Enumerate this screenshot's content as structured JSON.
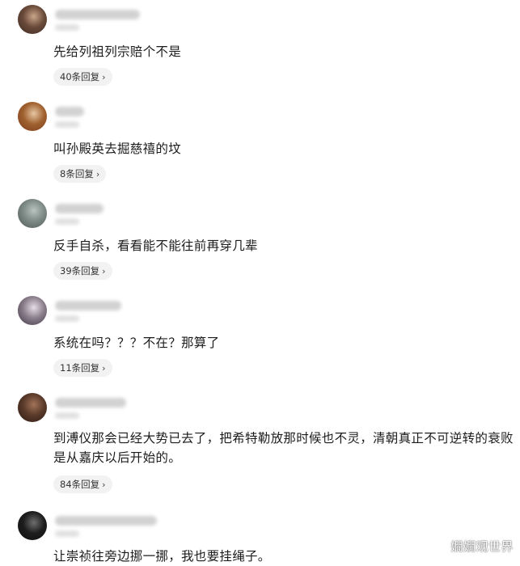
{
  "comments": [
    {
      "text": "先给列祖列宗赔个不是",
      "reply_count": "40条回复",
      "avatar_colors": [
        "#6a4a3a",
        "#c9a58a",
        "#3a2a22"
      ]
    },
    {
      "text": "叫孙殿英去掘慈禧的坟",
      "reply_count": "8条回复",
      "avatar_colors": [
        "#a0612f",
        "#e6c6a3",
        "#7a3a1b"
      ]
    },
    {
      "text": "反手自杀，看看能不能往前再穿几辈",
      "reply_count": "39条回复",
      "avatar_colors": [
        "#7d8a86",
        "#b9c3c0",
        "#4d5653"
      ]
    },
    {
      "text": "系统在吗？？？不在？那算了",
      "reply_count": "11条回复",
      "avatar_colors": [
        "#8b7e8c",
        "#e5dde6",
        "#3d3542"
      ]
    },
    {
      "text": "到溥仪那会已经大势已去了，把希特勒放那时候也不灵，清朝真正不可逆转的衰败是从嘉庆以后开始的。",
      "reply_count": "84条回复",
      "avatar_colors": [
        "#5a3a2a",
        "#a27358",
        "#2a1a12"
      ]
    },
    {
      "text": "让崇祯往旁边挪一挪，我也要挂绳子。",
      "reply_count": "",
      "avatar_colors": [
        "#1d1d1d",
        "#6e6e6e",
        "#0e0e0e"
      ]
    }
  ],
  "reply_chevron": "›",
  "watermark": "嫺嫺观世界"
}
